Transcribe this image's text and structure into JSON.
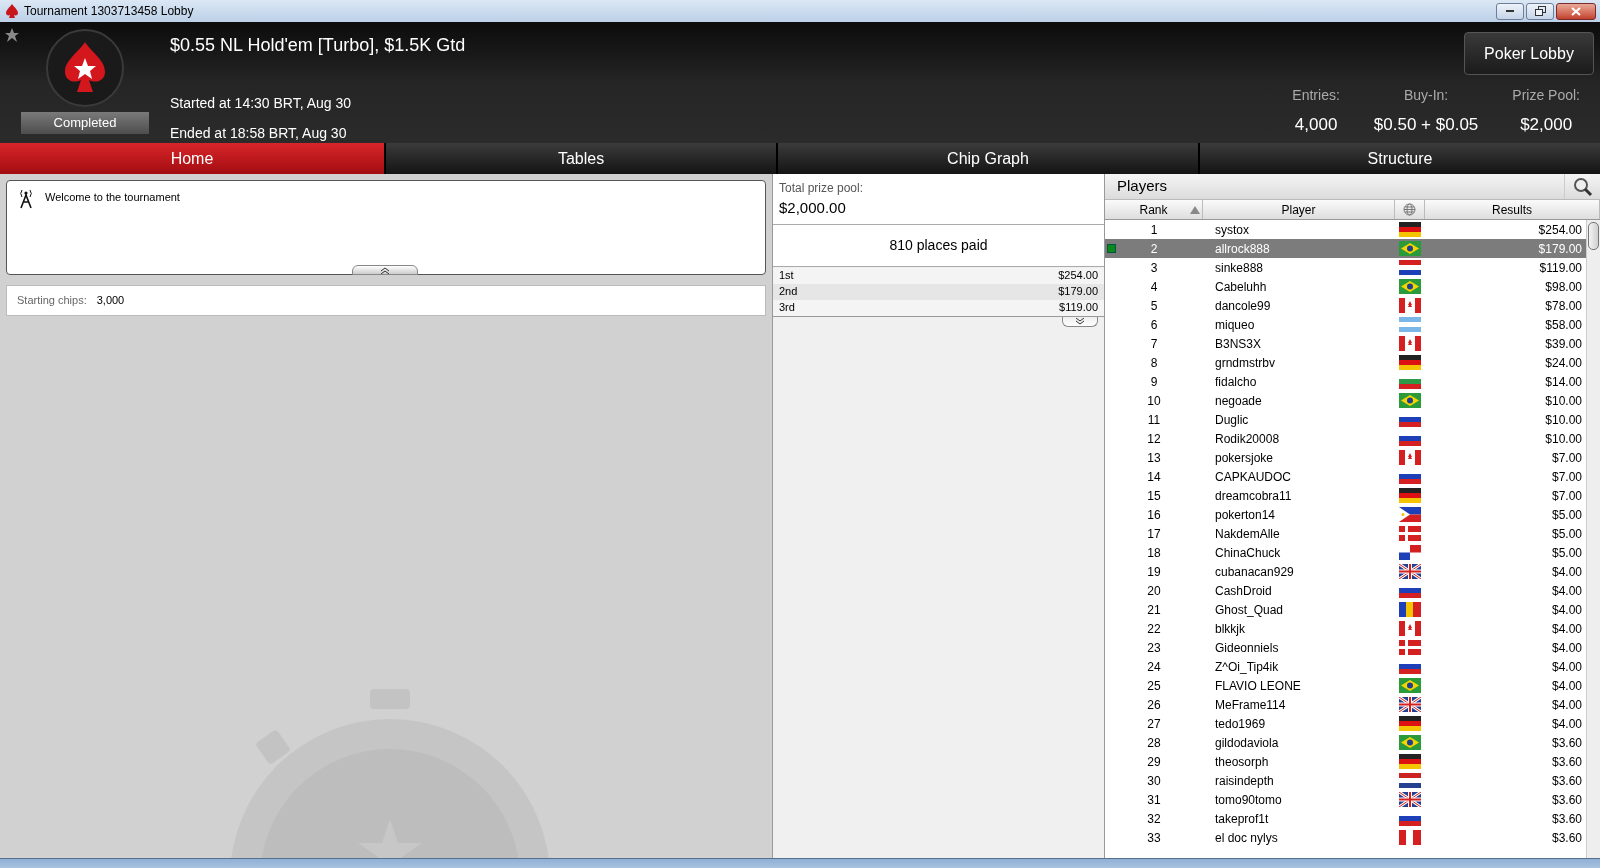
{
  "window": {
    "title": "Tournament 1303713458 Lobby"
  },
  "header": {
    "title": "$0.55 NL Hold'em [Turbo], $1.5K Gtd",
    "status": "Completed",
    "started": "Started at 14:30 BRT, Aug 30",
    "ended": "Ended at 18:58 BRT, Aug 30",
    "lobby_button": "Poker Lobby",
    "stats": [
      {
        "label": "Entries:",
        "value": "4,000"
      },
      {
        "label": "Buy-In:",
        "value": "$0.50 + $0.05"
      },
      {
        "label": "Prize Pool:",
        "value": "$2,000"
      }
    ]
  },
  "tabs": [
    {
      "label": "Home",
      "selected": true
    },
    {
      "label": "Tables",
      "selected": false
    },
    {
      "label": "Chip Graph",
      "selected": false
    },
    {
      "label": "Structure",
      "selected": false
    }
  ],
  "news": {
    "message": "Welcome to the tournament"
  },
  "info": {
    "label": "Starting chips:",
    "value": "3,000"
  },
  "prizes": {
    "label": "Total prize pool:",
    "total": "$2,000.00",
    "places": "810 places paid",
    "rows": [
      {
        "place": "1st",
        "amount": "$254.00"
      },
      {
        "place": "2nd",
        "amount": "$179.00"
      },
      {
        "place": "3rd",
        "amount": "$119.00"
      }
    ]
  },
  "players": {
    "title": "Players",
    "columns": [
      "Rank",
      "Player",
      "Results"
    ],
    "rows": [
      {
        "rank": "1",
        "player": "systox",
        "kind": "de",
        "result": "$254.00",
        "selected": false
      },
      {
        "rank": "2",
        "player": "allrock888",
        "kind": "br",
        "result": "$179.00",
        "selected": true
      },
      {
        "rank": "3",
        "player": "sinke888",
        "kind": "hr",
        "result": "$119.00",
        "selected": false
      },
      {
        "rank": "4",
        "player": "Cabeluhh",
        "kind": "br",
        "result": "$98.00",
        "selected": false
      },
      {
        "rank": "5",
        "player": "dancole99",
        "kind": "ca",
        "result": "$78.00",
        "selected": false
      },
      {
        "rank": "6",
        "player": "miqueo",
        "kind": "ar",
        "result": "$58.00",
        "selected": false
      },
      {
        "rank": "7",
        "player": "B3NS3X",
        "kind": "ca",
        "result": "$39.00",
        "selected": false
      },
      {
        "rank": "8",
        "player": "grndmstrbv",
        "kind": "de",
        "result": "$24.00",
        "selected": false
      },
      {
        "rank": "9",
        "player": "fidalcho",
        "kind": "bg",
        "result": "$14.00",
        "selected": false
      },
      {
        "rank": "10",
        "player": "negoade",
        "kind": "br",
        "result": "$10.00",
        "selected": false
      },
      {
        "rank": "11",
        "player": "Duglic",
        "kind": "ru",
        "result": "$10.00",
        "selected": false
      },
      {
        "rank": "12",
        "player": "Rodik20008",
        "kind": "ru",
        "result": "$10.00",
        "selected": false
      },
      {
        "rank": "13",
        "player": "pokersjoke",
        "kind": "ca",
        "result": "$7.00",
        "selected": false
      },
      {
        "rank": "14",
        "player": "CAPKAUDOC",
        "kind": "ru",
        "result": "$7.00",
        "selected": false
      },
      {
        "rank": "15",
        "player": "dreamcobra11",
        "kind": "de",
        "result": "$7.00",
        "selected": false
      },
      {
        "rank": "16",
        "player": "pokerton14",
        "kind": "ph",
        "result": "$5.00",
        "selected": false
      },
      {
        "rank": "17",
        "player": "NakdemAlle",
        "kind": "dk",
        "result": "$5.00",
        "selected": false
      },
      {
        "rank": "18",
        "player": "ChinaChuck",
        "kind": "pa",
        "result": "$5.00",
        "selected": false
      },
      {
        "rank": "19",
        "player": "cubanacan929",
        "kind": "gb",
        "result": "$4.00",
        "selected": false
      },
      {
        "rank": "20",
        "player": "CashDroid",
        "kind": "ru",
        "result": "$4.00",
        "selected": false
      },
      {
        "rank": "21",
        "player": "Ghost_Quad",
        "kind": "ro",
        "result": "$4.00",
        "selected": false
      },
      {
        "rank": "22",
        "player": "blkkjk",
        "kind": "ca",
        "result": "$4.00",
        "selected": false
      },
      {
        "rank": "23",
        "player": "Gideonniels",
        "kind": "dk",
        "result": "$4.00",
        "selected": false
      },
      {
        "rank": "24",
        "player": "Z^Oi_Tip4ik",
        "kind": "ru",
        "result": "$4.00",
        "selected": false
      },
      {
        "rank": "25",
        "player": "FLAVIO LEONE",
        "kind": "br",
        "result": "$4.00",
        "selected": false
      },
      {
        "rank": "26",
        "player": "MeFrame114",
        "kind": "gb",
        "result": "$4.00",
        "selected": false
      },
      {
        "rank": "27",
        "player": "tedo1969",
        "kind": "de",
        "result": "$4.00",
        "selected": false
      },
      {
        "rank": "28",
        "player": "gildodaviola",
        "kind": "br",
        "result": "$3.60",
        "selected": false
      },
      {
        "rank": "29",
        "player": "theosorph",
        "kind": "de",
        "result": "$3.60",
        "selected": false
      },
      {
        "rank": "30",
        "player": "raisindepth",
        "kind": "nl",
        "result": "$3.60",
        "selected": false
      },
      {
        "rank": "31",
        "player": "tomo90tomo",
        "kind": "gb",
        "result": "$3.60",
        "selected": false
      },
      {
        "rank": "32",
        "player": "takeprof1t",
        "kind": "ru",
        "result": "$3.60",
        "selected": false
      },
      {
        "rank": "33",
        "player": "el doc nylys",
        "kind": "pe",
        "result": "$3.60",
        "selected": false
      }
    ]
  }
}
